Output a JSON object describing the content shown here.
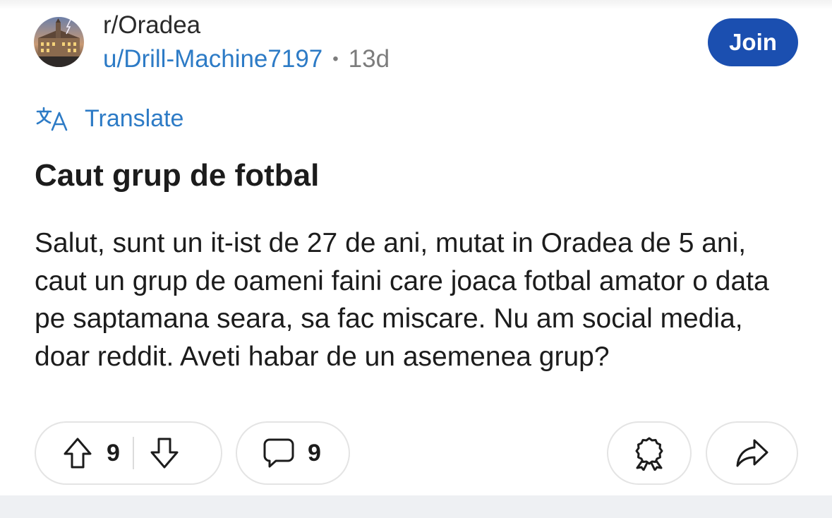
{
  "post": {
    "subreddit": "r/Oradea",
    "author": "u/Drill-Machine7197",
    "separator": "•",
    "age": "13d",
    "join_label": "Join",
    "translate_label": "Translate",
    "title": "Caut grup de fotbal",
    "body": "Salut, sunt un it-ist de 27 de ani, mutat in Oradea de 5 ani, caut un grup de oameni faini care joaca fotbal amator o data pe saptamana seara, sa fac miscare. Nu am social media, doar reddit. Aveti habar de un asemenea grup?"
  },
  "actions": {
    "upvote_count": "9",
    "comment_count": "9"
  },
  "icons": {
    "translate": "translate-icon",
    "upvote": "arrow-up-icon",
    "downvote": "arrow-down-icon",
    "comment": "speech-bubble-icon",
    "award": "award-ribbon-icon",
    "share": "share-arrow-icon"
  },
  "colors": {
    "join_button": "#1b4fb0",
    "link_blue": "#2d7bc6",
    "meta_gray": "#7c7c7c"
  }
}
